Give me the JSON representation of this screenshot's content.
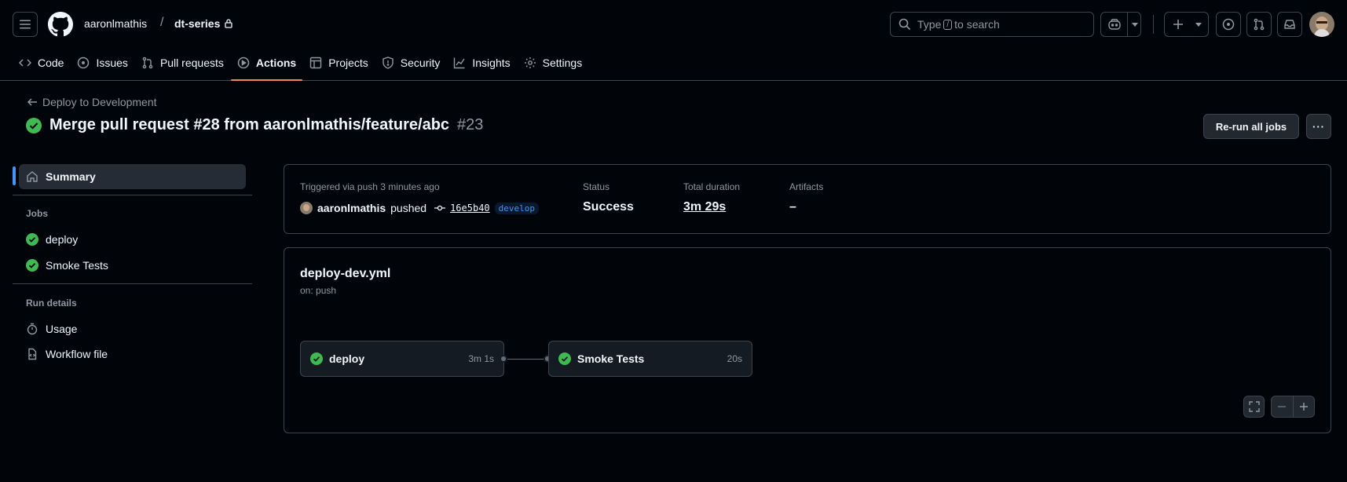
{
  "header": {
    "owner": "aaronlmathis",
    "separator": "/",
    "repo": "dt-series",
    "search_prefix": "Type",
    "search_key": "/",
    "search_suffix": "to search"
  },
  "tabs": [
    {
      "label": "Code",
      "icon": "code-icon"
    },
    {
      "label": "Issues",
      "icon": "issue-icon"
    },
    {
      "label": "Pull requests",
      "icon": "pull-request-icon"
    },
    {
      "label": "Actions",
      "icon": "play-icon",
      "active": true
    },
    {
      "label": "Projects",
      "icon": "table-icon"
    },
    {
      "label": "Security",
      "icon": "shield-icon"
    },
    {
      "label": "Insights",
      "icon": "graph-icon"
    },
    {
      "label": "Settings",
      "icon": "gear-icon"
    }
  ],
  "run": {
    "back_label": "Deploy to Development",
    "title": "Merge pull request #28 from aaronlmathis/feature/abc",
    "number": "#23",
    "rerun_label": "Re-run all jobs",
    "more_label": "···"
  },
  "sidebar": {
    "summary": "Summary",
    "jobs_heading": "Jobs",
    "jobs": [
      "deploy",
      "Smoke Tests"
    ],
    "run_details_heading": "Run details",
    "usage": "Usage",
    "workflow_file": "Workflow file"
  },
  "summary": {
    "trigger_label": "Triggered via push 3 minutes ago",
    "actor": "aaronlmathis",
    "action": "pushed",
    "sha": "16e5b40",
    "branch": "develop",
    "status_label": "Status",
    "status_value": "Success",
    "duration_label": "Total duration",
    "duration_value": "3m 29s",
    "artifacts_label": "Artifacts",
    "artifacts_value": "–"
  },
  "workflow": {
    "file": "deploy-dev.yml",
    "trigger": "on: push",
    "jobs": [
      {
        "name": "deploy",
        "time": "3m 1s"
      },
      {
        "name": "Smoke Tests",
        "time": "20s"
      }
    ]
  },
  "colors": {
    "success": "#3fb950",
    "accent": "#4493f8",
    "tab_underline": "#f78166",
    "background": "#010409",
    "border": "#3d444d"
  }
}
